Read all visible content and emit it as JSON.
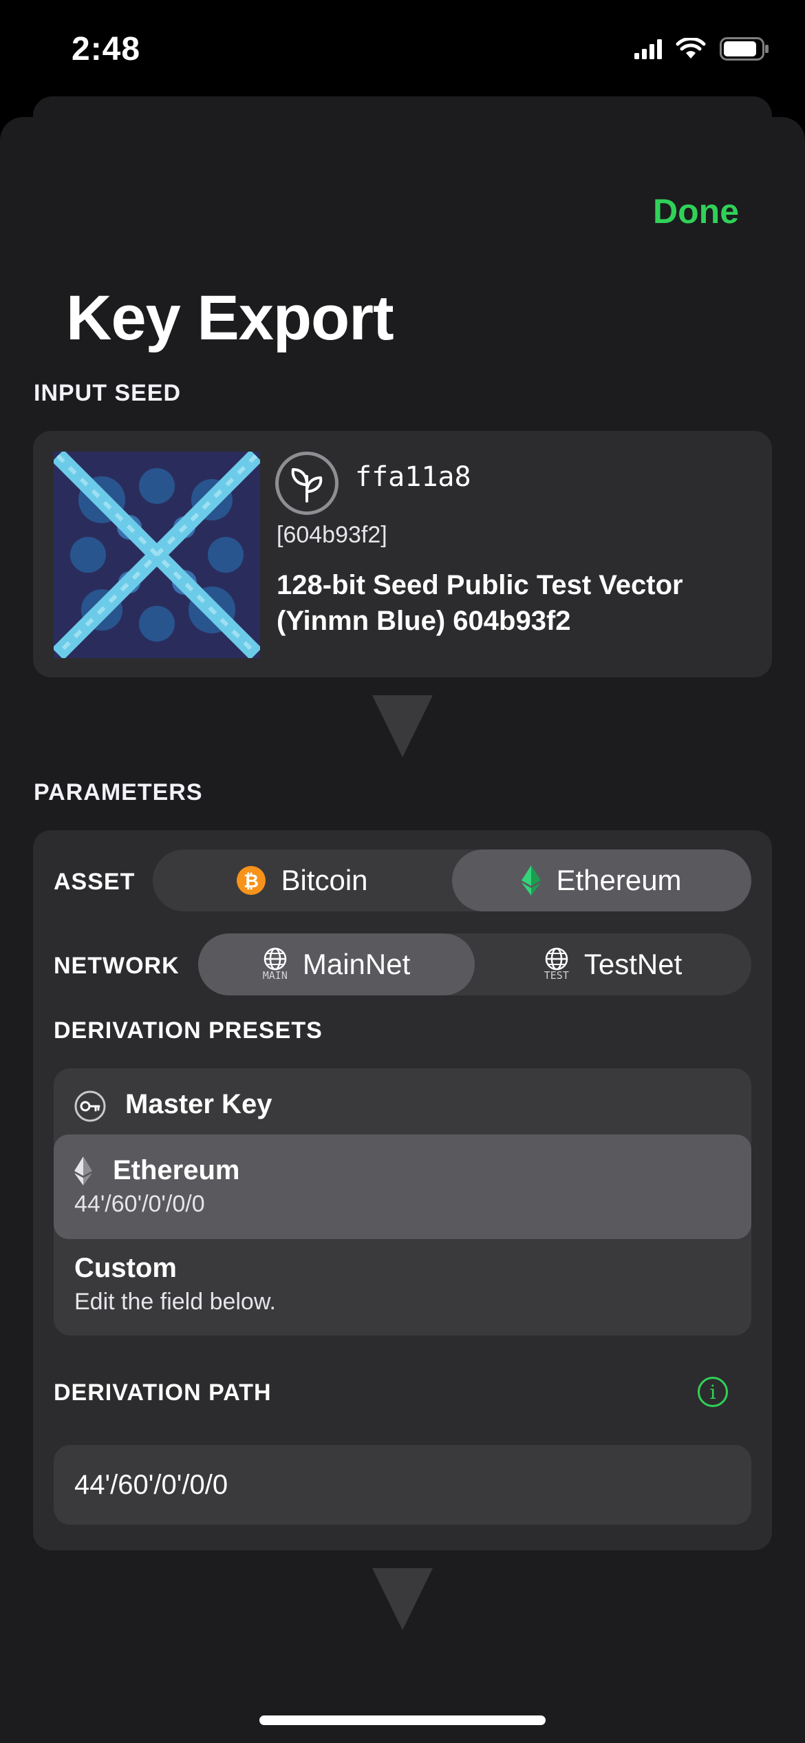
{
  "status_bar": {
    "time": "2:48"
  },
  "header": {
    "done_label": "Done",
    "title": "Key Export"
  },
  "input_seed": {
    "section_label": "INPUT SEED",
    "id": "ffa11a8",
    "digest": "[604b93f2]",
    "name": "128-bit Seed Public Test Vector (Yinmn Blue) 604b93f2"
  },
  "parameters": {
    "section_label": "PARAMETERS",
    "asset": {
      "label": "ASSET",
      "options": [
        {
          "label": "Bitcoin",
          "icon": "bitcoin-icon",
          "selected": false
        },
        {
          "label": "Ethereum",
          "icon": "ethereum-icon",
          "selected": true
        }
      ]
    },
    "network": {
      "label": "NETWORK",
      "options": [
        {
          "label": "MainNet",
          "icon_text": "MAIN",
          "selected": true
        },
        {
          "label": "TestNet",
          "icon_text": "TEST",
          "selected": false
        }
      ]
    },
    "presets": {
      "label": "DERIVATION PRESETS",
      "items": [
        {
          "title": "Master Key",
          "icon": "key-icon",
          "selected": false
        },
        {
          "title": "Ethereum",
          "subtitle": "44'/60'/0'/0/0",
          "icon": "ethereum-icon",
          "selected": true
        },
        {
          "title": "Custom",
          "subtitle": "Edit the field below.",
          "selected": false
        }
      ]
    },
    "derivation_path": {
      "label": "DERIVATION PATH",
      "value": "44'/60'/0'/0/0"
    }
  },
  "colors": {
    "accent": "#30d158",
    "background": "#1c1c1e",
    "card": "#2c2c2e",
    "control": "#3a3a3c",
    "selected": "#59595e",
    "bitcoin": "#f7931a",
    "lifehash_dark": "#2a2d5c",
    "lifehash_mid": "#29558f",
    "lifehash_light": "#6ccbe8"
  }
}
